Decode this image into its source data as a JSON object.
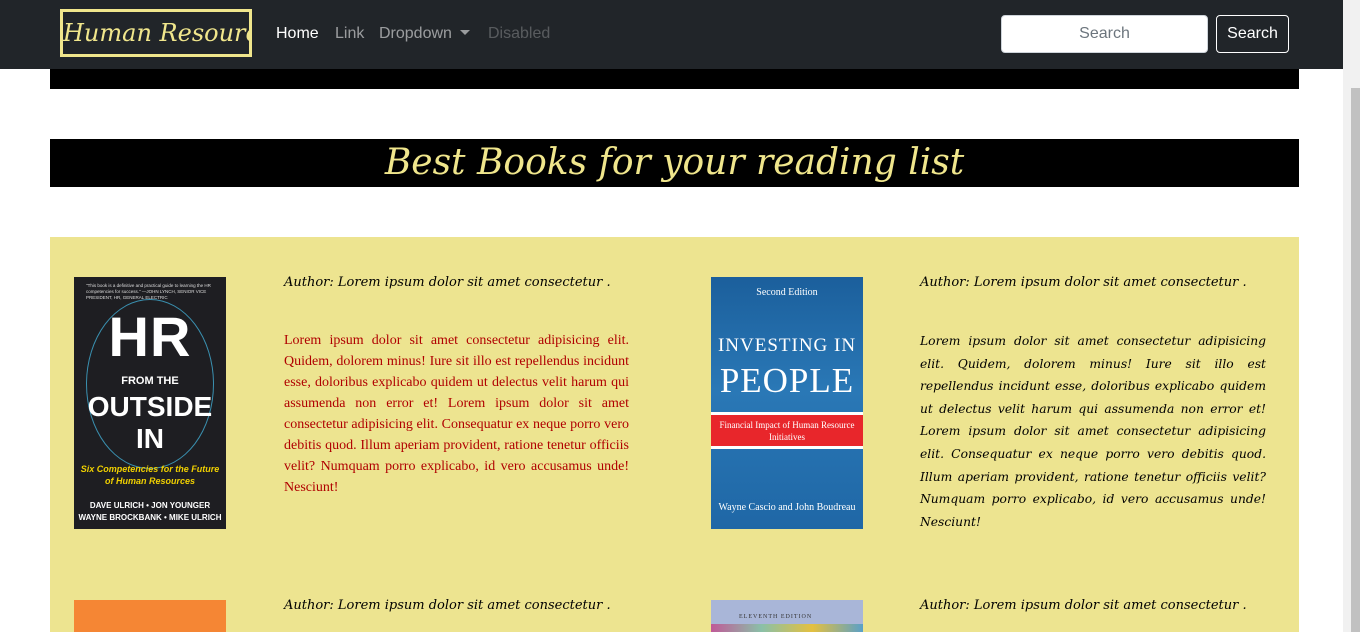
{
  "navbar": {
    "brand": "Human Resource",
    "links": {
      "home": "Home",
      "link": "Link",
      "dropdown": "Dropdown",
      "disabled": "Disabled"
    },
    "search_placeholder": "Search",
    "search_button": "Search"
  },
  "section": {
    "title": "Best Books for your reading list"
  },
  "books": [
    {
      "author": "Author: Lorem ipsum dolor sit amet consectetur .",
      "description": "Lorem ipsum dolor sit amet consectetur adipisicing elit. Quidem, dolorem minus! Iure sit illo est repellendus incidunt esse, doloribus explicabo quidem ut delectus velit harum qui assumenda non error et! Lorem ipsum dolor sit amet consectetur adipisicing elit. Consequatur ex neque porro vero debitis quod. Illum aperiam provident, ratione tenetur officiis velit? Numquam porro explicabo, id vero accusamus unde! Nesciunt!",
      "cover": {
        "praise": "\"This book is a definitive and practical guide to learning the HR competencies for success.\" —JOHN LYNCH, SENIOR VICE PRESIDENT, HR, GENERAL ELECTRIC",
        "title_1": "HR",
        "title_2": "FROM THE",
        "title_3": "OUTSIDE",
        "title_4": "IN",
        "subtitle": "Six Competencies for the Future of Human Resources",
        "authors": "DAVE ULRICH • JON YOUNGER WAYNE BROCKBANK • MIKE ULRICH"
      }
    },
    {
      "author": "Author: Lorem ipsum dolor sit amet consectetur .",
      "description": "Lorem ipsum dolor sit amet consectetur adipisicing elit. Quidem, dolorem minus! Iure sit illo est repellendus incidunt esse, doloribus explicabo quidem ut delectus velit harum qui assumenda non error et! Lorem ipsum dolor sit amet consectetur adipisicing elit. Consequatur ex neque porro vero debitis quod. Illum aperiam provident, ratione tenetur officiis velit? Numquam porro explicabo, id vero accusamus unde! Nesciunt!",
      "cover": {
        "edition": "Second Edition",
        "title_1": "INVESTING IN",
        "title_2": "PEOPLE",
        "subtitle": "Financial Impact of Human Resource Initiatives",
        "authors": "Wayne Cascio and John Boudreau"
      }
    },
    {
      "author": "Author: Lorem ipsum dolor sit amet consectetur ."
    },
    {
      "author": "Author: Lorem ipsum dolor sit amet consectetur .",
      "cover": {
        "edition": "ELEVENTH EDITION"
      }
    }
  ],
  "colors": {
    "navbar_bg": "#212529",
    "accent_gold": "#f0e68c",
    "books_bg": "#ede490",
    "description_red": "#b00000"
  }
}
